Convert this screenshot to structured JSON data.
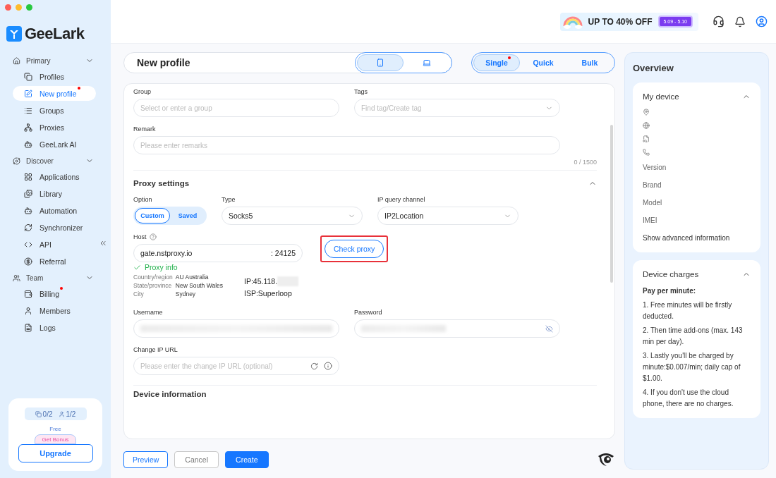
{
  "sidebar": {
    "logo": "GeeLark",
    "sections": [
      {
        "label": "Primary",
        "expanded": true,
        "items": [
          {
            "label": "Profiles",
            "selected": false,
            "dot": false
          },
          {
            "label": "New profile",
            "selected": true,
            "dot": true
          },
          {
            "label": "Groups",
            "selected": false,
            "dot": false
          },
          {
            "label": "Proxies",
            "selected": false,
            "dot": false
          },
          {
            "label": "GeeLark AI",
            "selected": false,
            "dot": false
          }
        ]
      },
      {
        "label": "Discover",
        "expanded": true,
        "items": [
          {
            "label": "Applications",
            "selected": false,
            "dot": false
          },
          {
            "label": "Library",
            "selected": false,
            "dot": false
          },
          {
            "label": "Automation",
            "selected": false,
            "dot": false
          },
          {
            "label": "Synchronizer",
            "selected": false,
            "dot": false
          },
          {
            "label": "API",
            "selected": false,
            "dot": false
          },
          {
            "label": "Referral",
            "selected": false,
            "dot": false
          }
        ]
      },
      {
        "label": "Team",
        "expanded": true,
        "items": [
          {
            "label": "Billing",
            "selected": false,
            "dot": true
          },
          {
            "label": "Members",
            "selected": false,
            "dot": false
          },
          {
            "label": "Logs",
            "selected": false,
            "dot": false
          }
        ]
      }
    ],
    "quota": {
      "devices": "0/2",
      "members": "1/2"
    },
    "plan": "Free",
    "bonus": "Get Bonus",
    "upgrade": "Upgrade"
  },
  "topbar": {
    "promo": "UP TO 40% OFF",
    "promo_dates": "5.09 - 5.10"
  },
  "header": {
    "title": "New profile",
    "device_tabs": [
      {
        "kind": "phone",
        "selected": true
      },
      {
        "kind": "laptop",
        "selected": false
      }
    ],
    "mode_tabs": [
      {
        "label": "Single",
        "selected": true,
        "dot": true
      },
      {
        "label": "Quick",
        "selected": false,
        "dot": false
      },
      {
        "label": "Bulk",
        "selected": false,
        "dot": false
      }
    ]
  },
  "form": {
    "group": {
      "label": "Group",
      "placeholder": "Select or enter a group"
    },
    "tags": {
      "label": "Tags",
      "placeholder": "Find tag/Create tag"
    },
    "remark": {
      "label": "Remark",
      "placeholder": "Please enter remarks",
      "counter": "0 / 1500"
    },
    "proxy": {
      "title": "Proxy settings",
      "expanded": true,
      "option": {
        "label": "Option",
        "choices": [
          {
            "label": "Custom",
            "selected": true
          },
          {
            "label": "Saved",
            "selected": false
          }
        ]
      },
      "type": {
        "label": "Type",
        "value": "Socks5"
      },
      "channel": {
        "label": "IP query channel",
        "value": "IP2Location"
      },
      "host": {
        "label": "Host",
        "value": "gate.nstproxy.io",
        "port": ": 24125"
      },
      "check_button": "Check proxy",
      "info": {
        "title": "Proxy info",
        "ok": true,
        "rows": [
          {
            "label": "Country/region",
            "value": "AU Australia"
          },
          {
            "label": "State/province",
            "value": "New South Wales"
          },
          {
            "label": "City",
            "value": "Sydney"
          }
        ],
        "ip": "IP:45.118.",
        "isp": "ISP:Superloop"
      },
      "username": {
        "label": "Username"
      },
      "password": {
        "label": "Password"
      },
      "change_ip": {
        "label": "Change IP URL",
        "placeholder": "Please enter the change IP URL (optional)"
      }
    },
    "next_section": "Device information"
  },
  "actions": [
    {
      "label": "Preview",
      "kind": "outline"
    },
    {
      "label": "Cancel",
      "kind": "plain"
    },
    {
      "label": "Create",
      "kind": "primary"
    }
  ],
  "overview": {
    "title": "Overview",
    "my_device": {
      "title": "My device",
      "expanded": true,
      "fields": [
        "Version",
        "Brand",
        "Model",
        "IMEI"
      ],
      "link": "Show advanced information"
    },
    "charges": {
      "title": "Device charges",
      "expanded": true,
      "heading": "Pay per minute:",
      "items": [
        "1. Free minutes will be firstly deducted.",
        "2. Then time add-ons (max. 143 min per day).",
        "3. Lastly you'll be charged by minute:$0.007/min; daily cap of $1.00.",
        "4. If you don't use the cloud phone, there are no charges."
      ]
    }
  }
}
